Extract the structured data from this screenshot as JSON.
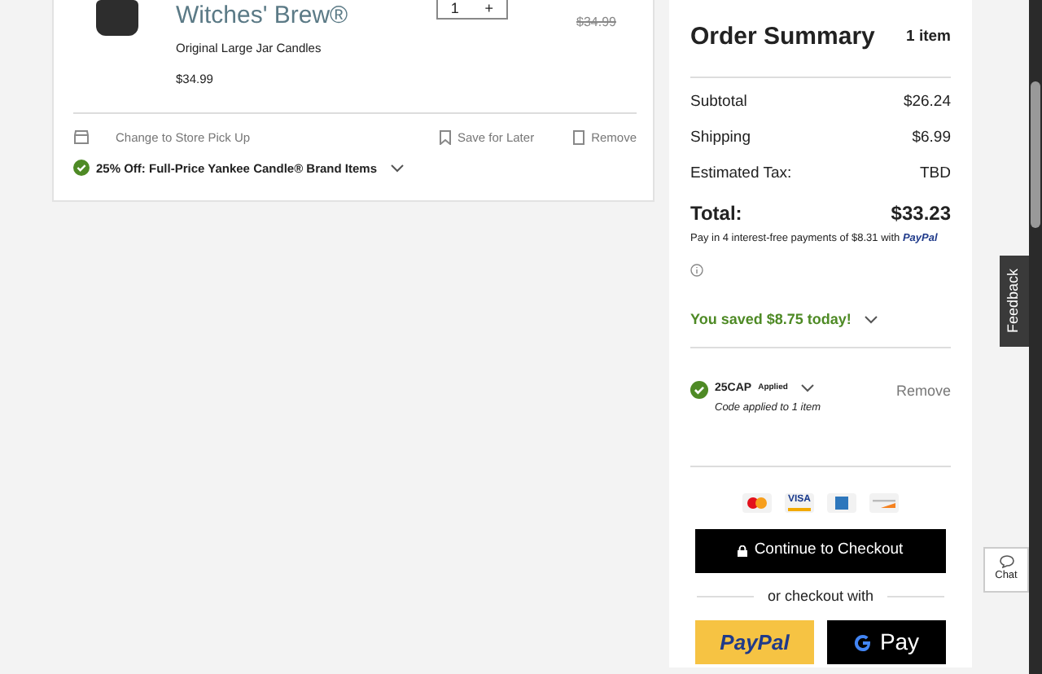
{
  "cart_item": {
    "title": "Witches' Brew®",
    "category": "Original Large Jar Candles",
    "price": "$34.99",
    "quantity": "1",
    "quantity_plus": "+",
    "original_price": "$34.99",
    "store_pickup": "Change to Store Pick Up",
    "save_for_later": "Save for Later",
    "remove": "Remove",
    "promotion": "25% Off: Full-Price Yankee Candle® Brand Items"
  },
  "order_summary": {
    "title": "Order Summary",
    "item_count": "1 item",
    "lines": [
      {
        "label": "Subtotal",
        "value": "$26.24"
      },
      {
        "label": "Shipping",
        "value": "$6.99"
      },
      {
        "label": "Estimated Tax:",
        "value": "TBD"
      }
    ],
    "total_label": "Total:",
    "total_value": "$33.23",
    "installments": "Pay in 4 interest-free payments of $8.31 with",
    "installments_brand": "PayPal",
    "savings": "You saved $8.75 today!",
    "coupon": {
      "code": "25CAP",
      "status": "Applied",
      "note": "Code applied to 1 item",
      "remove": "Remove"
    },
    "payment_cards": [
      {
        "kind": "mastercard"
      },
      {
        "kind": "visa",
        "label": "VISA"
      },
      {
        "kind": "amex"
      },
      {
        "kind": "discover"
      }
    ],
    "checkout": "Continue to Checkout",
    "alt_checkout": "or checkout with",
    "paypal": "PayPal",
    "gpay": "Pay"
  },
  "feedback": "Feedback",
  "chat": "Chat"
}
